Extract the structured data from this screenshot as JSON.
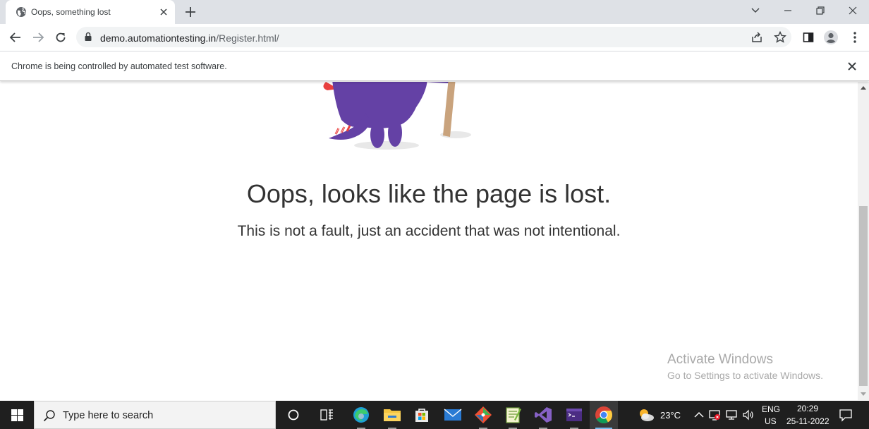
{
  "browser": {
    "tab": {
      "title": "Oops, something lost",
      "icon": "globe-icon"
    },
    "url": {
      "host": "demo.automationtesting.in",
      "path": "/Register.html/"
    },
    "infobar": {
      "message": "Chrome is being controlled by automated test software."
    }
  },
  "page": {
    "headline": "Oops, looks like the page is lost.",
    "subline": "This is not a fault, just an accident that was not intentional."
  },
  "watermark": {
    "title": "Activate Windows",
    "subtitle": "Go to Settings to activate Windows."
  },
  "taskbar": {
    "search_placeholder": "Type here to search",
    "apps": [
      "task-view",
      "edge",
      "file-explorer",
      "microsoft-store",
      "mail",
      "git-client",
      "notepad-plus-plus",
      "visual-studio",
      "terminal",
      "chrome"
    ],
    "weather": {
      "temperature": "23°C"
    },
    "language": {
      "code": "ENG",
      "region": "US"
    },
    "clock": {
      "time": "20:29",
      "date": "25-11-2022"
    }
  },
  "colors": {
    "tabstrip": "#dee1e6",
    "taskbar": "#1f1f1f",
    "monster": "#6441a5",
    "headline_text": "#333333"
  }
}
